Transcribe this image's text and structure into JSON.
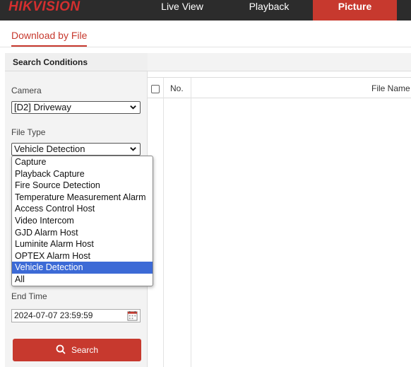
{
  "brand": {
    "logo_text": "HIKVISION"
  },
  "nav": {
    "items": [
      {
        "label": "Live View"
      },
      {
        "label": "Playback"
      },
      {
        "label": "Picture"
      }
    ],
    "active": "Picture"
  },
  "subtab": {
    "label": "Download by File"
  },
  "search_panel": {
    "title": "Search Conditions",
    "camera_label": "Camera",
    "camera_value": "[D2] Driveway",
    "file_type_label": "File Type",
    "file_type_value": "Vehicle Detection",
    "end_time_label": "End Time",
    "end_time_value": "2024-07-07 23:59:59",
    "search_button": "Search"
  },
  "file_type_options": [
    "Capture",
    "Playback Capture",
    "Fire Source Detection",
    "Temperature Measurement Alarm",
    "Access Control Host",
    "Video Intercom",
    "GJD Alarm Host",
    "Luminite Alarm Host",
    "OPTEX Alarm Host",
    "Vehicle Detection",
    "All"
  ],
  "file_type_selected_index": 9,
  "table": {
    "columns": [
      "No.",
      "File Name"
    ]
  },
  "colors": {
    "brand_red": "#c7392e",
    "topbar": "#2c2c2c",
    "selection_blue": "#3c6ad6"
  }
}
